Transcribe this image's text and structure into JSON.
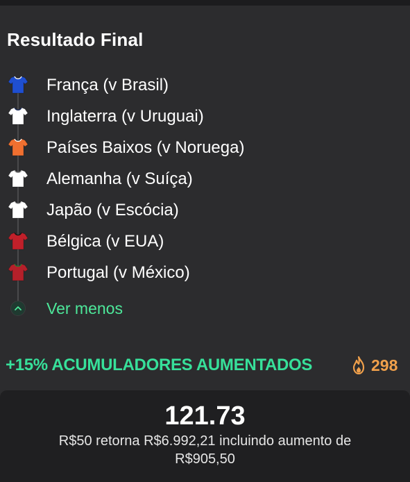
{
  "market": {
    "title": "Resultado Final"
  },
  "selections": [
    {
      "label": "França (v Brasil)",
      "shirt_color": "#1f4fd1",
      "shirt_detail": "#ffffff"
    },
    {
      "label": "Inglaterra (v Uruguai)",
      "shirt_color": "#ffffff",
      "shirt_detail": "#1a2a5a"
    },
    {
      "label": "Países Baixos (v Noruega)",
      "shirt_color": "#f07030",
      "shirt_detail": "#ffffff"
    },
    {
      "label": "Alemanha (v Suíça)",
      "shirt_color": "#ffffff",
      "shirt_detail": "#999999"
    },
    {
      "label": "Japão (v Escócia)",
      "shirt_color": "#ffffff",
      "shirt_detail": "#cccccc"
    },
    {
      "label": "Bélgica (v EUA)",
      "shirt_color": "#c0202a",
      "shirt_detail": "#111111"
    },
    {
      "label": "Portugal (v México)",
      "shirt_color": "#b5202a",
      "shirt_detail": "#2a7a30"
    }
  ],
  "toggle": {
    "label": "Ver menos",
    "icon": "chevron-up-icon"
  },
  "promo": {
    "text": "+15% ACUMULADORES AUMENTADOS",
    "icon": "flame-icon",
    "count": "298",
    "text_color": "#37e09a",
    "count_color": "#f0a04b"
  },
  "summary": {
    "odds": "121.73",
    "description": "R$50 retorna R$6.992,21 incluindo aumento de R$905,50"
  }
}
